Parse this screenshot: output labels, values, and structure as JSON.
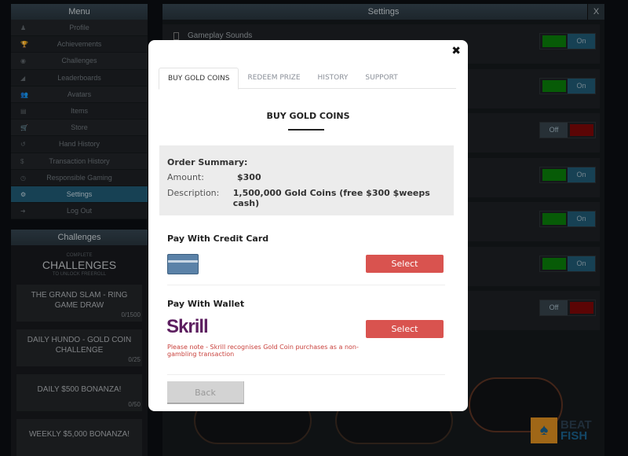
{
  "menu": {
    "title": "Menu",
    "items": [
      {
        "label": "Profile",
        "icon": "user-icon",
        "glyph": "♟"
      },
      {
        "label": "Achievements",
        "icon": "trophy-icon",
        "glyph": "🏆"
      },
      {
        "label": "Challenges",
        "icon": "target-icon",
        "glyph": "◉"
      },
      {
        "label": "Leaderboards",
        "icon": "bars-icon",
        "glyph": "◢"
      },
      {
        "label": "Avatars",
        "icon": "users-icon",
        "glyph": "👥"
      },
      {
        "label": "Items",
        "icon": "card-icon",
        "glyph": "▤"
      },
      {
        "label": "Store",
        "icon": "cart-icon",
        "glyph": "🛒"
      },
      {
        "label": "Hand History",
        "icon": "history-icon",
        "glyph": "↺"
      },
      {
        "label": "Transaction History",
        "icon": "dollar-icon",
        "glyph": "$"
      },
      {
        "label": "Responsible Gaming",
        "icon": "clock-icon",
        "glyph": "◷"
      },
      {
        "label": "Settings",
        "icon": "gear-icon",
        "glyph": "⚙",
        "active": true
      },
      {
        "label": "Log Out",
        "icon": "logout-icon",
        "glyph": "➜"
      }
    ]
  },
  "challenges": {
    "title": "Challenges",
    "pre": "COMPLETE",
    "big": "CHALLENGES",
    "post": "TO UNLOCK FREEROLL",
    "cards": [
      {
        "name": "THE GRAND SLAM - RING GAME DRAW",
        "progress": "0/1500"
      },
      {
        "name": "DAILY HUNDO - GOLD COIN CHALLENGE",
        "progress": "0/25"
      },
      {
        "name": "DAILY $500 BONANZA!",
        "progress": "0/50"
      },
      {
        "name": "WEEKLY $5,000 BONANZA!",
        "progress": ""
      }
    ]
  },
  "settings": {
    "title": "Settings",
    "close": "X",
    "first_label": "Gameplay Sounds",
    "toggles": [
      "On",
      "On",
      "Off",
      "On",
      "On",
      "On",
      "Off"
    ]
  },
  "modal": {
    "close": "✖",
    "tabs": [
      "BUY GOLD COINS",
      "REDEEM PRIZE",
      "HISTORY",
      "SUPPORT"
    ],
    "title": "BUY GOLD COINS",
    "summary": {
      "heading": "Order Summary:",
      "amount_label": "Amount:",
      "amount": "$300",
      "desc_label": "Description:",
      "desc": "1,500,000 Gold Coins (free $300 $weeps cash)"
    },
    "credit": {
      "heading": "Pay With Credit Card",
      "select": "Select"
    },
    "wallet": {
      "heading": "Pay With Wallet",
      "brand": "Skrill",
      "select": "Select",
      "note": "Please note - Skrill recognises Gold Coin purchases as a non-gambling transaction"
    },
    "back": "Back"
  },
  "watermark": {
    "line1": "BEAT",
    "line2": "FISH"
  },
  "colors": {
    "accent": "#1f5770",
    "select": "#d9534f",
    "on": "#0a7a0a",
    "off": "#7a0707"
  }
}
